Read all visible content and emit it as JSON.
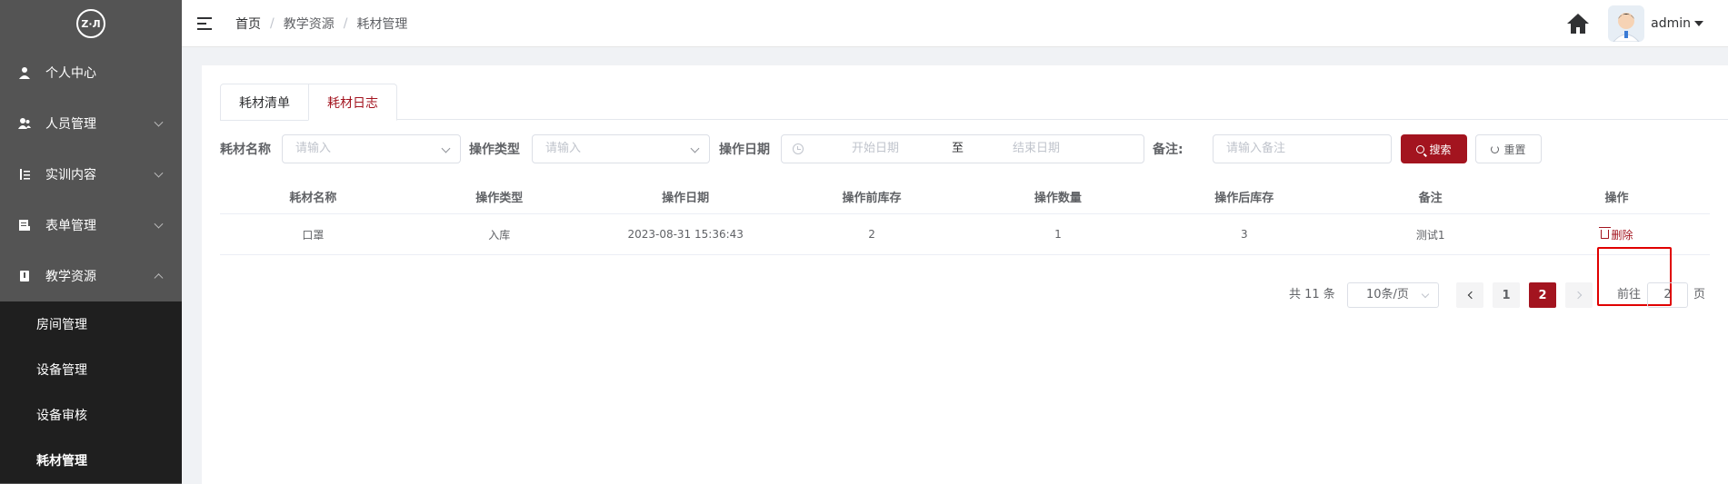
{
  "logo": {
    "text": "Z·Л"
  },
  "sidebar": {
    "items": [
      {
        "label": "个人中心",
        "icon": "user-icon",
        "has_arrow": false
      },
      {
        "label": "人员管理",
        "icon": "users-icon",
        "has_arrow": true
      },
      {
        "label": "实训内容",
        "icon": "list-icon",
        "has_arrow": true
      },
      {
        "label": "表单管理",
        "icon": "form-icon",
        "has_arrow": true
      },
      {
        "label": "教学资源",
        "icon": "book-icon",
        "has_arrow": true,
        "expanded": true
      }
    ],
    "subitems": [
      {
        "label": "房间管理"
      },
      {
        "label": "设备管理"
      },
      {
        "label": "设备审核"
      },
      {
        "label": "耗材管理",
        "active": true
      }
    ]
  },
  "header": {
    "breadcrumb": [
      "首页",
      "教学资源",
      "耗材管理"
    ],
    "user": "admin"
  },
  "tabs": [
    {
      "label": "耗材清单"
    },
    {
      "label": "耗材日志",
      "active": true
    }
  ],
  "filter": {
    "name_label": "耗材名称",
    "name_placeholder": "请输入",
    "type_label": "操作类型",
    "type_placeholder": "请输入",
    "date_label": "操作日期",
    "date_start_placeholder": "开始日期",
    "date_to": "至",
    "date_end_placeholder": "结束日期",
    "remark_label": "备注:",
    "remark_placeholder": "请输入备注",
    "search_label": "搜索",
    "reset_label": "重置"
  },
  "table": {
    "columns": [
      "耗材名称",
      "操作类型",
      "操作日期",
      "操作前库存",
      "操作数量",
      "操作后库存",
      "备注",
      "操作"
    ],
    "rows": [
      [
        "口罩",
        "入库",
        "2023-08-31 15:36:43",
        "2",
        "1",
        "3",
        "测试1",
        "删除"
      ]
    ]
  },
  "pagination": {
    "total": "共 11 条",
    "page_size": "10条/页",
    "pages": [
      "1",
      "2"
    ],
    "current": "2",
    "goto_prefix": "前往",
    "goto_value": "2",
    "goto_suffix": "页"
  },
  "colors": {
    "accent": "#a3141f",
    "sidebar": "#545454",
    "submenu": "#1f1f1f",
    "highlight": "#e00000"
  }
}
